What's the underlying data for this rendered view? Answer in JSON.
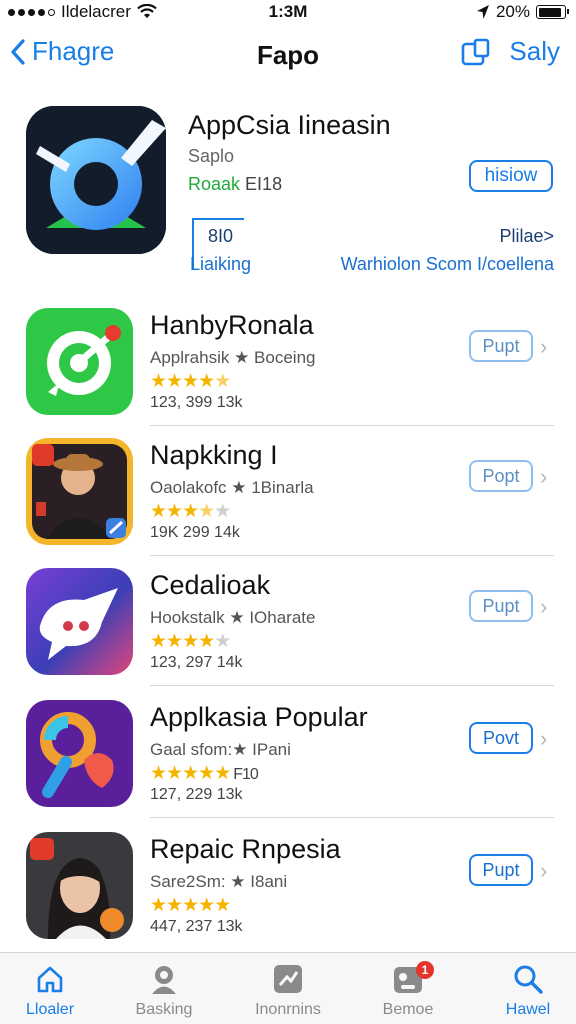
{
  "status_bar": {
    "carrier": "Ildelacrer",
    "time": "1:3M",
    "battery": "20%",
    "battery_level": 0.9
  },
  "nav": {
    "back_label": "Fhagre",
    "title": "Fapo",
    "right_label": "Saly"
  },
  "featured": {
    "title": "AppCsia Iineasin",
    "subtitle": "Saplo",
    "rank_green": "Roaak",
    "rank_gray": "EI18",
    "button_label": "hisiow",
    "stat_value": "8I0",
    "stat_label": "Liaiking",
    "rating_label": "Plilae>",
    "link_label": "Warhiolon Scom I/coellena"
  },
  "apps": [
    {
      "name": "HanbyRonala",
      "subtitle": "Applrahsik ★ Boceing",
      "rating": 4.5,
      "stats": "123, 399  13k",
      "button": "Pupt"
    },
    {
      "name": "Napkking I",
      "subtitle": "Oaolakofc ★ 1Binarla",
      "rating": 3.5,
      "stats": "19K  299  14k",
      "button": "Popt"
    },
    {
      "name": "Cedalioak",
      "subtitle": "Hookstalk ★ IOharate",
      "rating": 4,
      "stats": "123, 297  14k",
      "button": "Pupt"
    },
    {
      "name": "Applkasia Popular",
      "subtitle": "Gaal sfom:★ IPani",
      "rating": 5,
      "rating_suffix": "F10",
      "stats": "127, 229  13k",
      "button": "Povt"
    },
    {
      "name": "Repaic Rnpesia",
      "subtitle": "Sare2Sm: ★ I8ani",
      "rating": 5,
      "stats": "447, 237  13k",
      "button": "Pupt"
    }
  ],
  "tabs": [
    {
      "label": "Lloaler",
      "icon": "home-icon",
      "active": true
    },
    {
      "label": "Basking",
      "icon": "person-icon",
      "active": false
    },
    {
      "label": "Inonrnins",
      "icon": "updates-icon",
      "active": false
    },
    {
      "label": "Bemoe",
      "icon": "games-icon",
      "active": false,
      "badge": "1"
    },
    {
      "label": "Hawel",
      "icon": "search-icon",
      "active": true
    }
  ],
  "colors": {
    "accent": "#1a7ee8",
    "star": "#f4b400",
    "rank_green": "#1faa3a",
    "badge": "#e5342b"
  }
}
